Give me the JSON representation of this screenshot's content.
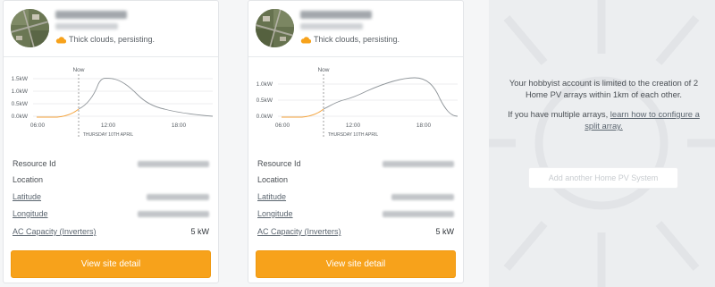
{
  "colors": {
    "accent": "#f7a21b",
    "forecast_line": "#8e9499",
    "actual_line": "#f4a23a"
  },
  "cards": [
    {
      "weather_icon": "cloud-icon",
      "weather_text": "Thick clouds, persisting.",
      "chart": {
        "now_label": "Now",
        "date_label": "THURSDAY 10TH APRIL",
        "y_ticks": [
          "1.5kW",
          "1.0kW",
          "0.5kW",
          "0.0kW"
        ],
        "x_ticks": [
          "06:00",
          "12:00",
          "18:00"
        ]
      },
      "details": {
        "resource_id_label": "Resource Id",
        "location_label": "Location",
        "latitude_label": "Latitude",
        "longitude_label": "Longitude",
        "ac_capacity_label": "AC Capacity (Inverters)",
        "ac_capacity_value": "5 kW"
      },
      "button_label": "View site detail"
    },
    {
      "weather_icon": "cloud-icon",
      "weather_text": "Thick clouds, persisting.",
      "chart": {
        "now_label": "Now",
        "date_label": "THURSDAY 10TH APRIL",
        "y_ticks": [
          "1.0kW",
          "0.5kW",
          "0.0kW"
        ],
        "x_ticks": [
          "06:00",
          "12:00",
          "18:00"
        ]
      },
      "details": {
        "resource_id_label": "Resource Id",
        "location_label": "Location",
        "latitude_label": "Latitude",
        "longitude_label": "Longitude",
        "ac_capacity_label": "AC Capacity (Inverters)",
        "ac_capacity_value": "5 kW"
      },
      "button_label": "View site detail"
    }
  ],
  "info_panel": {
    "message": "Your hobbyist account is limited to the creation of 2 Home PV arrays within 1km of each other.",
    "multi_prefix": "If you have multiple arrays, ",
    "multi_link": "learn how to configure a split array.",
    "add_button_label": "Add another Home PV System"
  }
}
